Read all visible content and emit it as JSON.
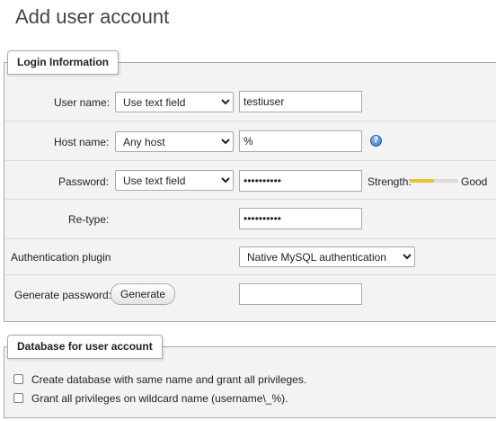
{
  "page": {
    "title": "Add user account"
  },
  "login": {
    "legend": "Login Information",
    "username": {
      "label": "User name:",
      "mode": "Use text field",
      "value": "testiuser"
    },
    "hostname": {
      "label": "Host name:",
      "mode": "Any host",
      "value": "%",
      "help_icon": "help-icon"
    },
    "password": {
      "label": "Password:",
      "mode": "Use text field",
      "value": "••••••••••",
      "strength_label": "Strength:",
      "strength_value": "Good",
      "strength_level": 0.5
    },
    "retype": {
      "label": "Re-type:",
      "value": "••••••••••"
    },
    "auth_plugin": {
      "label": "Authentication plugin",
      "value": "Native MySQL authentication"
    },
    "generate": {
      "label": "Generate password:",
      "button": "Generate",
      "value": ""
    }
  },
  "database": {
    "legend": "Database for user account",
    "options": [
      {
        "label": "Create database with same name and grant all privileges.",
        "checked": false
      },
      {
        "label": "Grant all privileges on wildcard name (username\\_%).",
        "checked": false
      }
    ]
  },
  "colors": {
    "panel_bg": "#f3f3f3",
    "strength_fill": "#e9c233",
    "help_icon": "#2d6fc5"
  }
}
